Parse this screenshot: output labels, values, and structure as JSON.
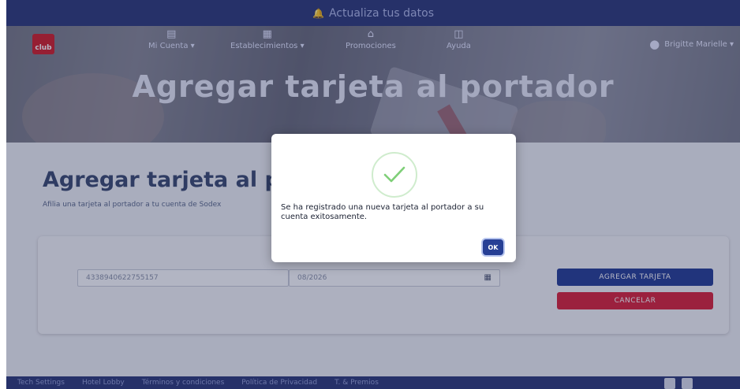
{
  "notice": {
    "text": "Actualiza tus datos",
    "icon": "bell-icon"
  },
  "header": {
    "logo_text": "club",
    "nav": [
      {
        "label": "Mi Cuenta ▾",
        "icon": "wallet-icon"
      },
      {
        "label": "Establecimientos ▾",
        "icon": "store-icon"
      },
      {
        "label": "Promociones",
        "icon": "promo-icon"
      },
      {
        "label": "Ayuda",
        "icon": "help-icon"
      }
    ],
    "user": {
      "name": "Brigitte Marielle ▾",
      "icon": "user-icon"
    }
  },
  "hero": {
    "title": "Agregar tarjeta al portador"
  },
  "main": {
    "heading": "Agregar tarjeta al port",
    "description": "Afilia una tarjeta al portador a tu cuenta de Sodex",
    "card_number_value": "4338940622755157",
    "expiry_value": "08/2026",
    "add_button": "AGREGAR TARJETA",
    "cancel_button": "CANCELAR"
  },
  "modal": {
    "message": "Se ha registrado una nueva tarjeta al portador a su cuenta exitosamente.",
    "ok_label": "OK"
  },
  "footer": {
    "links": [
      "Tech Settings",
      "Hotel Lobby",
      "Términos y condiciones",
      "Política de Privacidad",
      "T. & Premios"
    ]
  },
  "colors": {
    "brand_navy": "#2d3a7a",
    "primary_button": "#263f95",
    "danger_button": "#d9233a",
    "success_check": "#7fcf78"
  }
}
